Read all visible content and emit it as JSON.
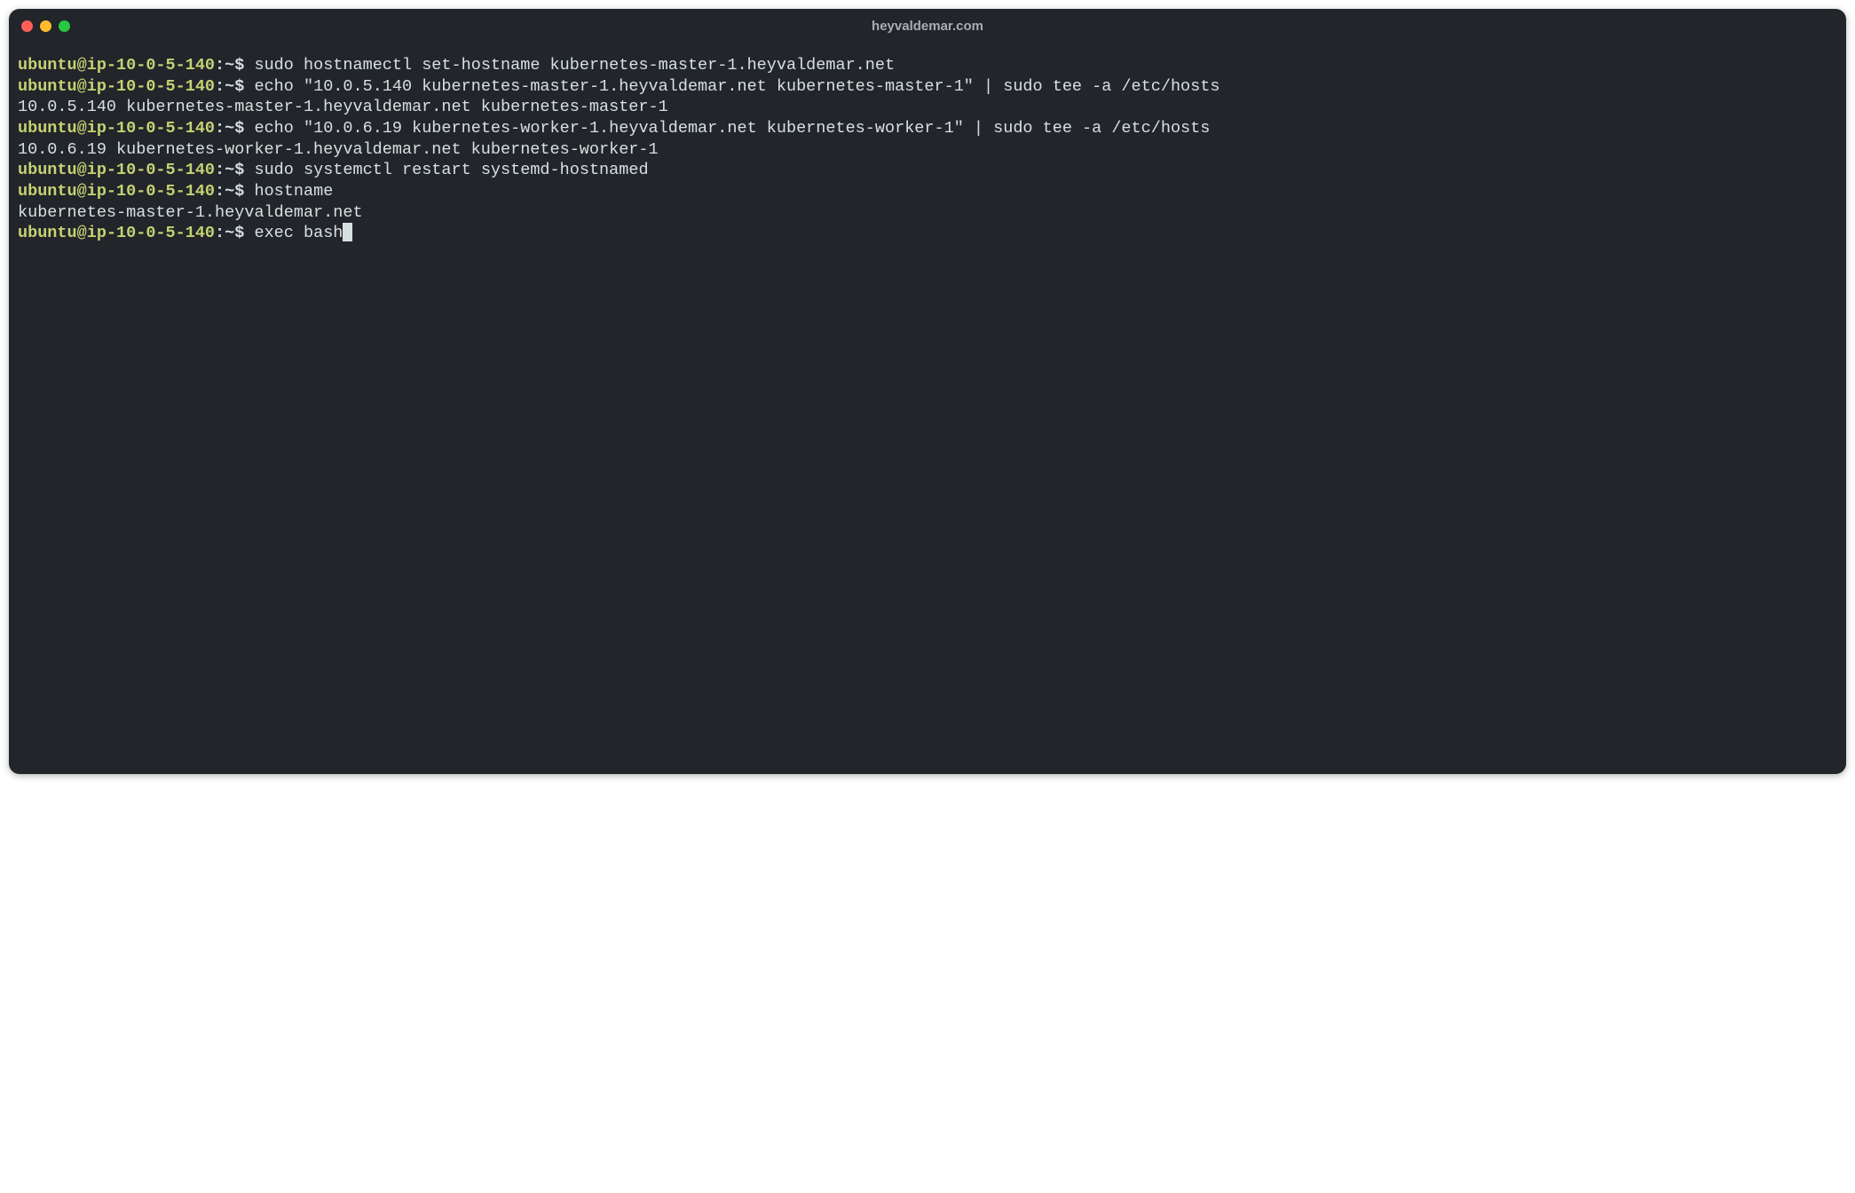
{
  "window": {
    "title": "heyvaldemar.com"
  },
  "prompt": {
    "userhost": "ubuntu@ip-10-0-5-140",
    "sep": ":",
    "path": "~",
    "dollar": "$"
  },
  "lines": {
    "l1_cmd": " sudo hostnamectl set-hostname kubernetes-master-1.heyvaldemar.net",
    "l2_cmd": " echo \"10.0.5.140 kubernetes-master-1.heyvaldemar.net kubernetes-master-1\" | sudo tee -a /etc/hosts",
    "l3_out": "10.0.5.140 kubernetes-master-1.heyvaldemar.net kubernetes-master-1",
    "l4_cmd": " echo \"10.0.6.19 kubernetes-worker-1.heyvaldemar.net kubernetes-worker-1\" | sudo tee -a /etc/hosts",
    "l5_out": "10.0.6.19 kubernetes-worker-1.heyvaldemar.net kubernetes-worker-1",
    "l6_cmd": " sudo systemctl restart systemd-hostnamed",
    "l7_cmd": " hostname",
    "l8_out": "kubernetes-master-1.heyvaldemar.net",
    "l9_cmd": " exec bash"
  }
}
